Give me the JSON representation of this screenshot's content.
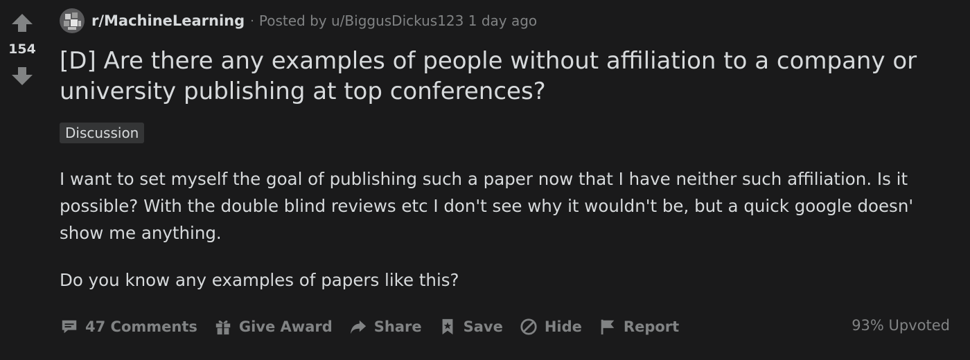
{
  "vote": {
    "count": "154"
  },
  "post": {
    "subreddit": "r/MachineLearning",
    "separator": "·",
    "posted_by_prefix": "Posted by",
    "author": "u/BiggusDickus123",
    "age": "1 day ago",
    "title": "[D] Are there any examples of people without affiliation to a company or university publishing at top conferences?",
    "flair": "Discussion",
    "body": [
      "I want to set myself the goal of publishing such a paper now that I have neither such affiliation. Is it possible? With the double blind reviews etc I don't see why it wouldn't be, but a quick google doesn' show me anything.",
      "Do you know any examples of papers like this?"
    ]
  },
  "actions": {
    "comments": "47 Comments",
    "give_award": "Give Award",
    "share": "Share",
    "save": "Save",
    "hide": "Hide",
    "report": "Report"
  },
  "stats": {
    "upvoted": "93% Upvoted"
  },
  "icons": {
    "upvote": "upvote-arrow-icon",
    "downvote": "downvote-arrow-icon",
    "comments": "comment-bubble-icon",
    "give_award": "gift-icon",
    "share": "share-arrow-icon",
    "save": "bookmark-icon",
    "hide": "hide-circle-icon",
    "report": "flag-icon"
  },
  "colors": {
    "background": "#1a1a1b",
    "text": "#d7dadc",
    "muted": "#818384",
    "flair_bg": "#343536"
  }
}
